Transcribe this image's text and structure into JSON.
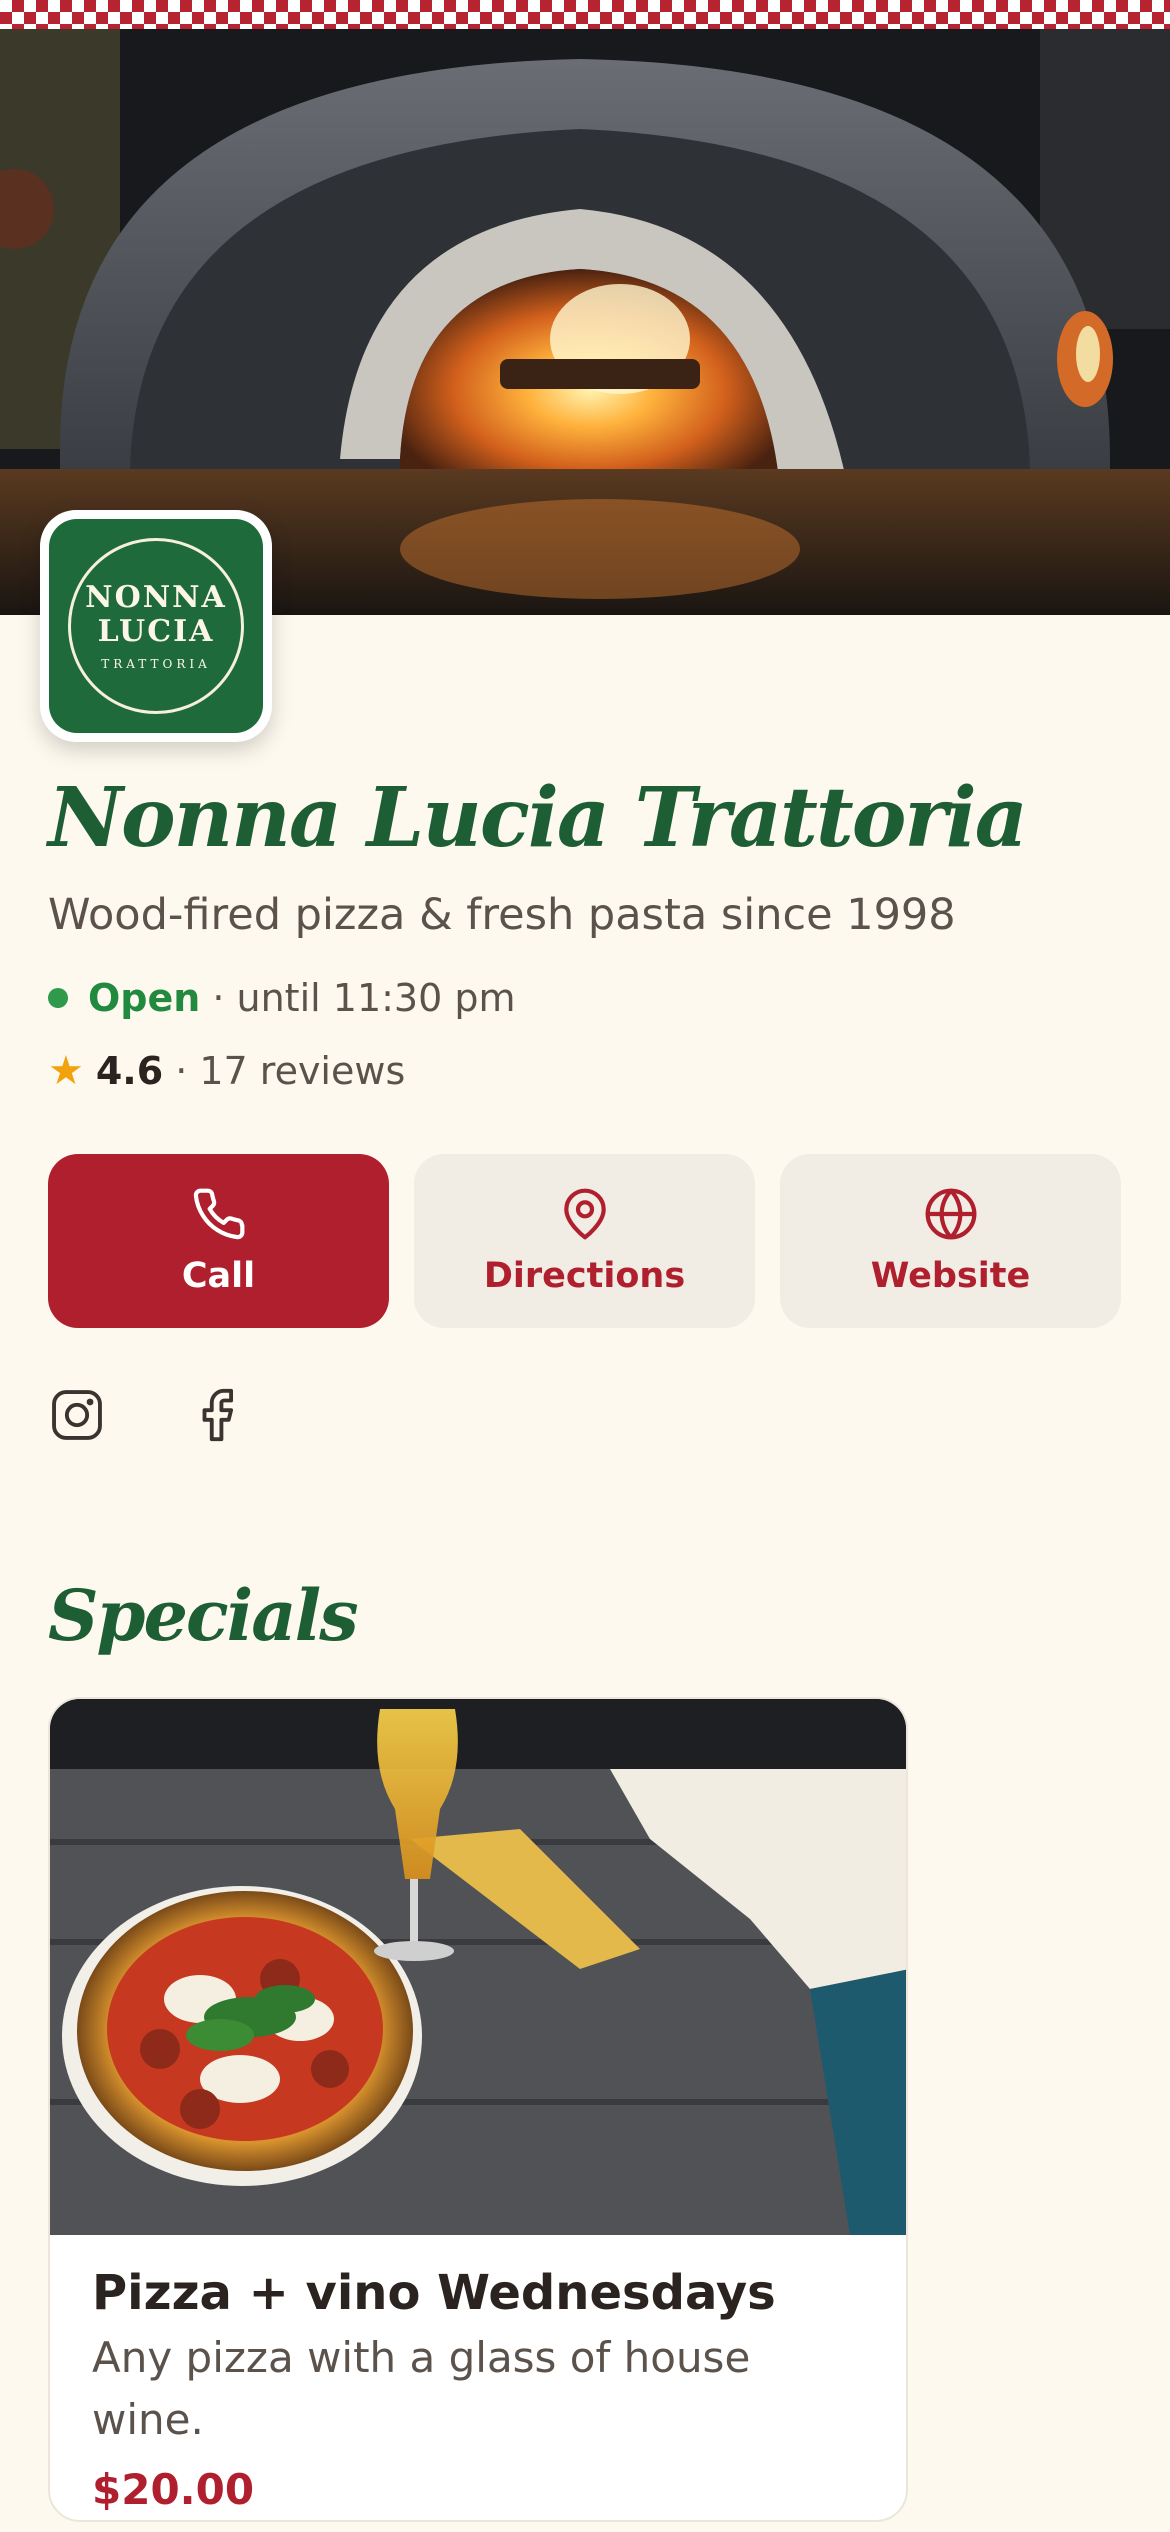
{
  "restaurant": {
    "name": "Nonna Lucia Trattoria",
    "tagline": "Wood-fired pizza & fresh pasta since 1998",
    "logo": {
      "line1": "NONNA",
      "line2": "LUCIA",
      "sub": "TRATTORIA"
    }
  },
  "status": {
    "open_label": "Open",
    "hours_text": "· until 11:30 pm",
    "color": "#2f9a4c"
  },
  "rating": {
    "value": "4.6",
    "reviews_text": "· 17 reviews",
    "star_color": "#f2a20c"
  },
  "actions": [
    {
      "label": "Call",
      "icon": "phone-icon"
    },
    {
      "label": "Directions",
      "icon": "map-pin-icon"
    },
    {
      "label": "Website",
      "icon": "globe-icon"
    }
  ],
  "socials": [
    {
      "icon": "instagram-icon"
    },
    {
      "icon": "facebook-icon"
    }
  ],
  "specials": {
    "title": "Specials",
    "items": [
      {
        "title": "Pizza + vino Wednesdays",
        "description": "Any pizza with a glass of house wine.",
        "price": "$20.00"
      }
    ]
  },
  "colors": {
    "brand_red": "#b01f2e",
    "brand_green": "#1e5e34",
    "background": "#fdf9ef"
  }
}
